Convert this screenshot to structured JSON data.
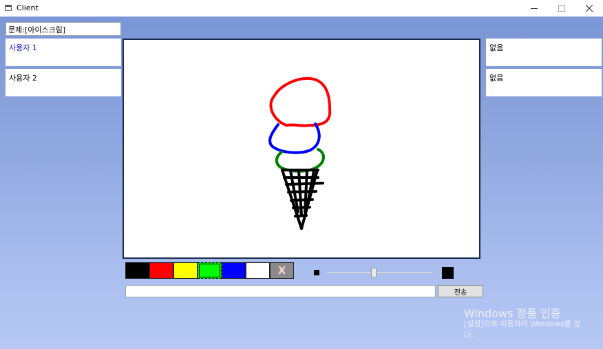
{
  "window": {
    "title": "Client"
  },
  "topic": {
    "text": "문제:[아이스크림]"
  },
  "users_left": [
    {
      "name": "사용자 1",
      "color": "#1010d0"
    },
    {
      "name": "사용자 2",
      "color": "#000000"
    }
  ],
  "users_right": [
    {
      "name": "없음"
    },
    {
      "name": "없음"
    }
  ],
  "palette": {
    "colors": [
      "#000000",
      "#ff0000",
      "#ffff00",
      "#00ff00",
      "#0000ff",
      "#ffffff"
    ],
    "selected": "#00ff00",
    "erase_label": "X"
  },
  "brush_slider": {
    "value_fraction": 0.45
  },
  "chat": {
    "value": "",
    "send_label": "전송"
  },
  "watermark": {
    "title": "Windows 정품 인증",
    "line1": "[설정]으로 이동하여 Windows를 정",
    "line2": "다."
  }
}
